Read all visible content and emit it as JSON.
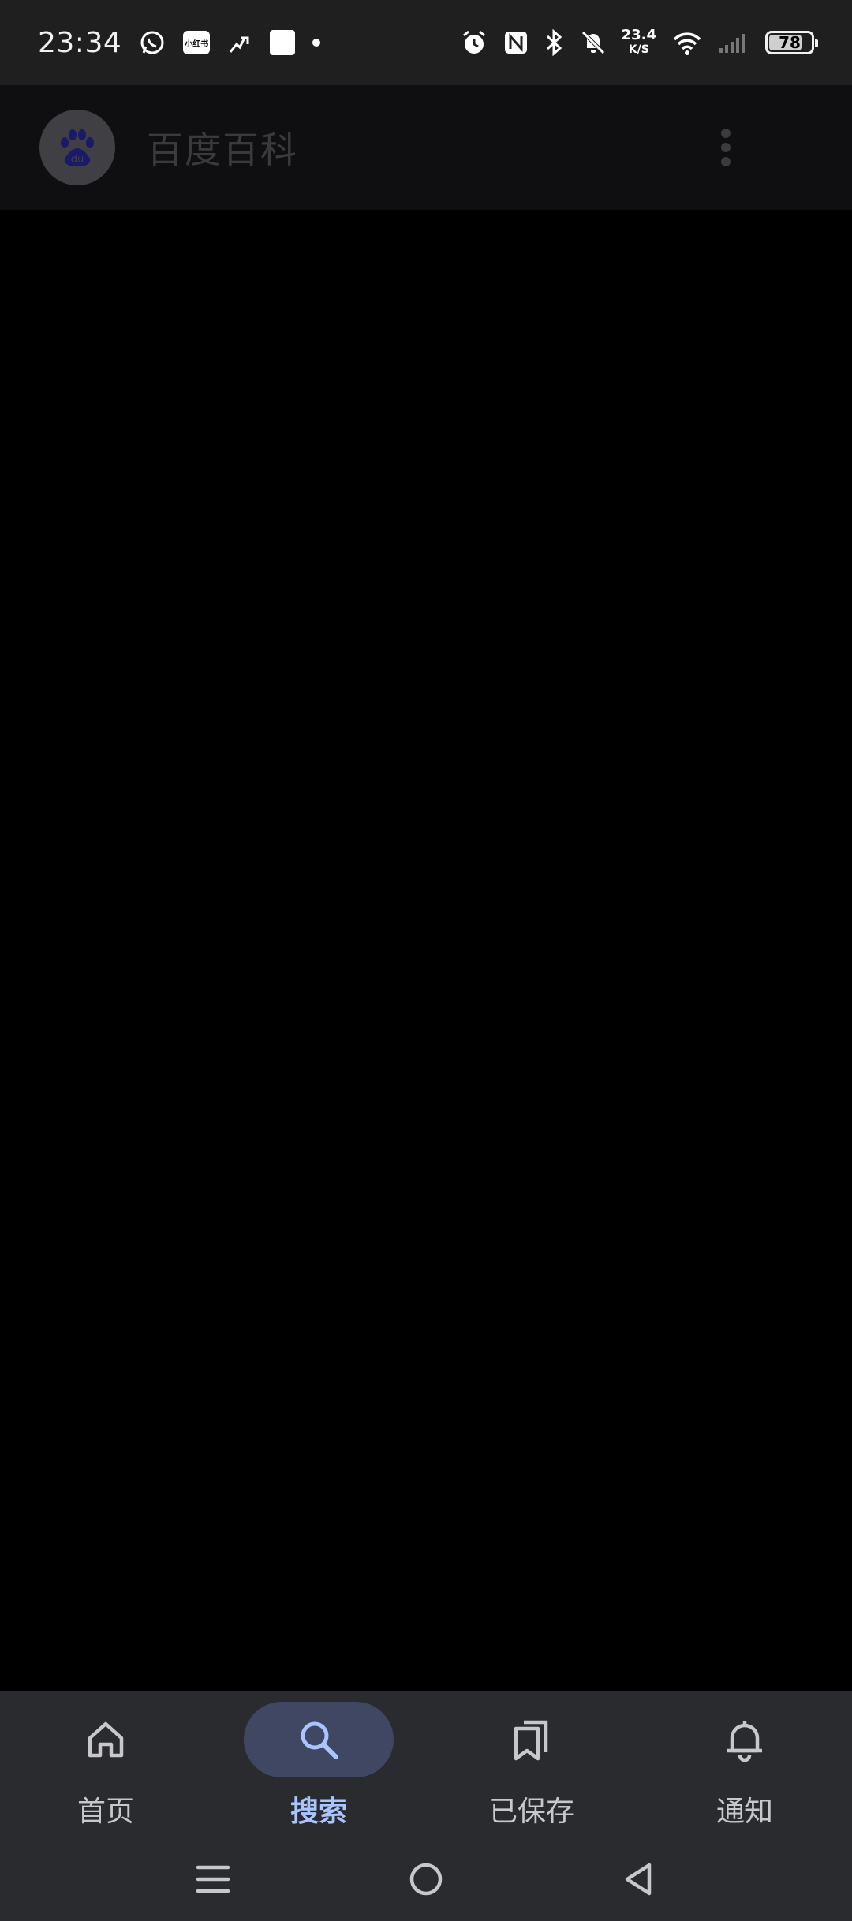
{
  "status_bar": {
    "time": "23:34",
    "xhs_label": "小红书",
    "net_speed_value": "23.4",
    "net_speed_unit": "K/S",
    "battery_level": "78",
    "battery_fraction": 0.78,
    "icons": [
      "whatsapp-icon",
      "xiaohongshu-icon",
      "activity-icon",
      "square-icon",
      "dot-icon",
      "alarm-icon",
      "nfc-icon",
      "bluetooth-icon",
      "mute-icon",
      "wifi-icon",
      "signal-icon",
      "battery-icon"
    ]
  },
  "app_bar": {
    "title": "百度百科",
    "logo_icon": "baidu-paw-icon",
    "menu_icon": "more-vertical-icon"
  },
  "bottom_nav": {
    "items": [
      {
        "label": "首页",
        "icon": "home-icon",
        "active": false
      },
      {
        "label": "搜索",
        "icon": "search-icon",
        "active": true
      },
      {
        "label": "已保存",
        "icon": "bookmarks-icon",
        "active": false
      },
      {
        "label": "通知",
        "icon": "bell-icon",
        "active": false
      }
    ],
    "active_color": "#a9c4ff",
    "active_pill_color": "#3f4762"
  },
  "system_nav": {
    "icons": [
      "menu-icon",
      "home-circle-icon",
      "back-icon"
    ]
  }
}
